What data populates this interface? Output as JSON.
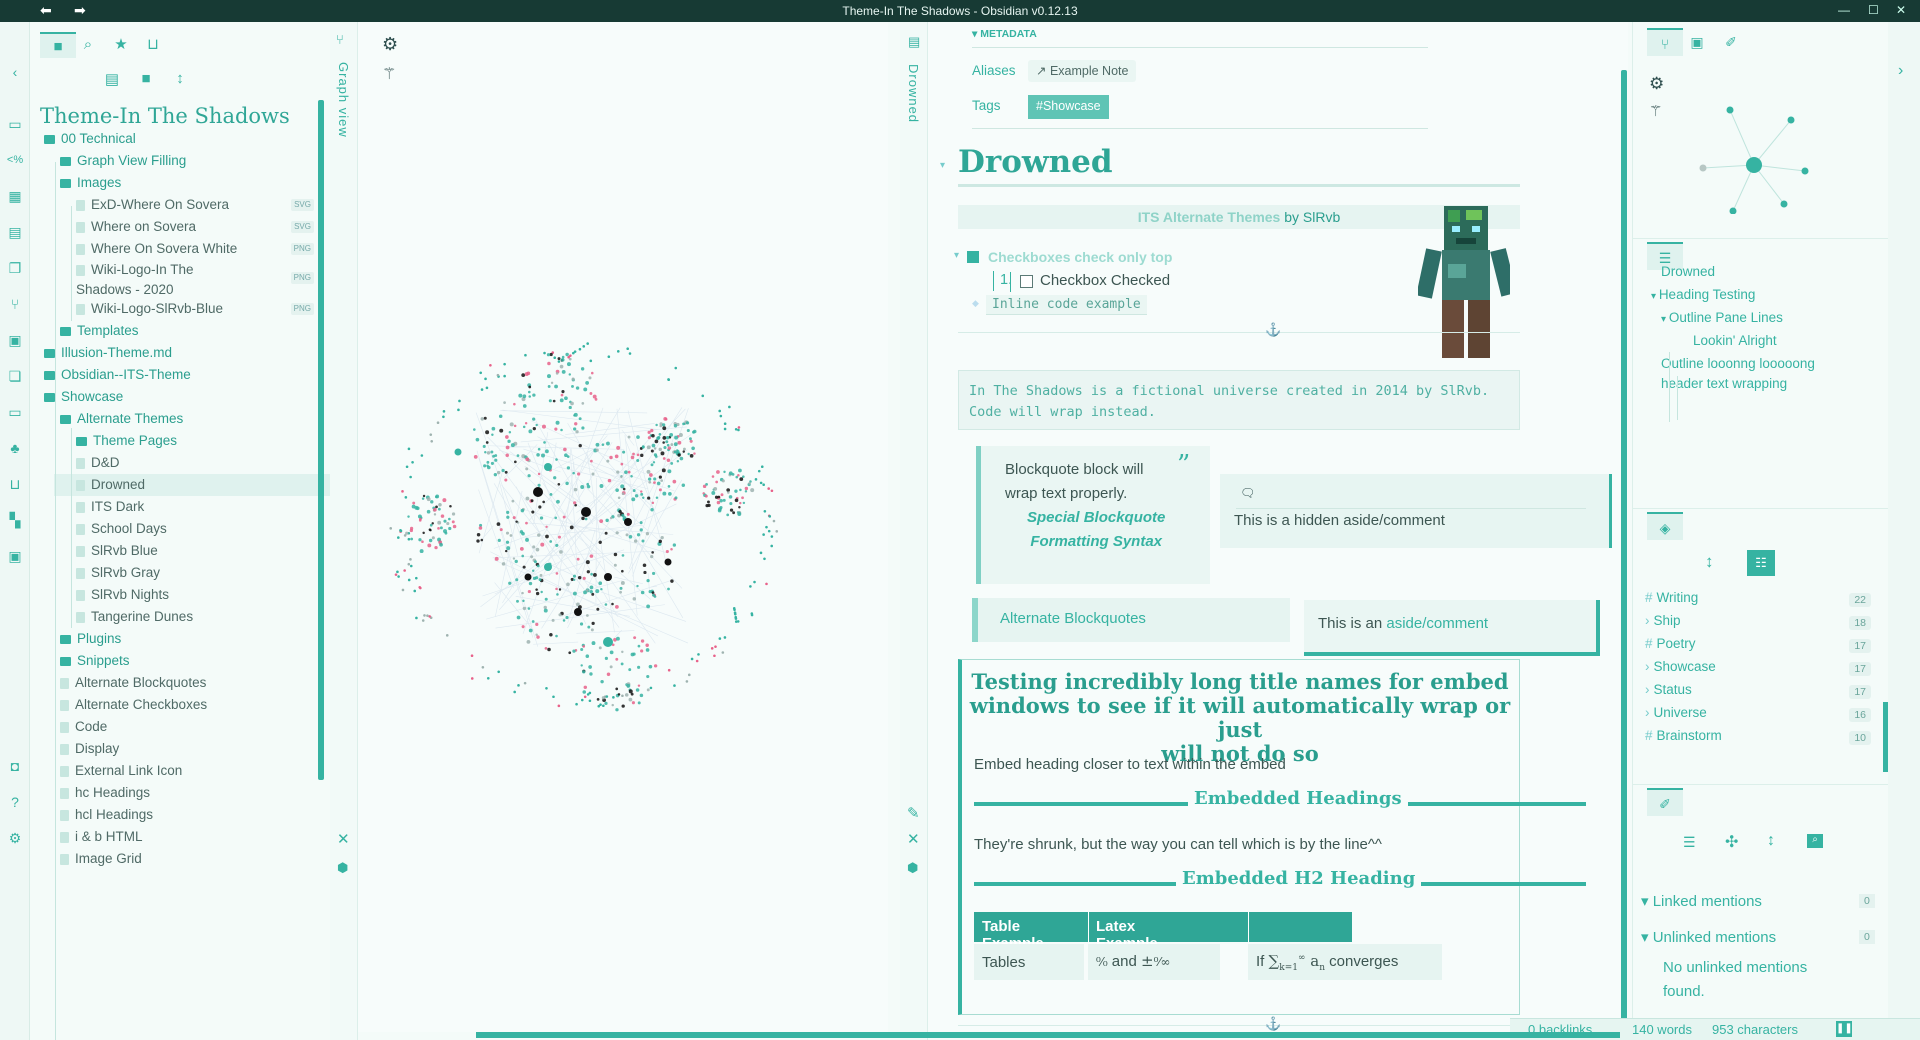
{
  "window": {
    "title": "Theme-In The Shadows - Obsidian v0.12.13"
  },
  "explorer": {
    "vault_name": "Theme-In The Shadows",
    "items": [
      {
        "label": "00 Technical",
        "type": "folder",
        "depth": 0
      },
      {
        "label": "Graph View Filling",
        "type": "folder",
        "depth": 1
      },
      {
        "label": "Images",
        "type": "folder",
        "depth": 1
      },
      {
        "label": "ExD-Where On Sovera",
        "type": "file",
        "depth": 2,
        "badge": "SVG"
      },
      {
        "label": "Where on Sovera",
        "type": "file",
        "depth": 2,
        "badge": "SVG"
      },
      {
        "label": "Where On Sovera White",
        "type": "file",
        "depth": 2,
        "badge": "PNG"
      },
      {
        "label": "Wiki-Logo-In The",
        "label2": "Shadows - 2020",
        "type": "file",
        "depth": 2,
        "badge": "PNG"
      },
      {
        "label": "Wiki-Logo-SlRvb-Blue",
        "type": "file",
        "depth": 2,
        "badge": "PNG"
      },
      {
        "label": "Templates",
        "type": "folder",
        "depth": 1
      },
      {
        "label": "Illusion-Theme.md",
        "type": "folder",
        "depth": 0
      },
      {
        "label": "Obsidian--ITS-Theme",
        "type": "folder",
        "depth": 0
      },
      {
        "label": "Showcase",
        "type": "folder",
        "depth": 0
      },
      {
        "label": "Alternate Themes",
        "type": "folder",
        "depth": 1
      },
      {
        "label": "Theme Pages",
        "type": "folder",
        "depth": 2
      },
      {
        "label": "D&D",
        "type": "file",
        "depth": 2
      },
      {
        "label": "Drowned",
        "type": "file",
        "depth": 2,
        "selected": true
      },
      {
        "label": "ITS Dark",
        "type": "file",
        "depth": 2
      },
      {
        "label": "School Days",
        "type": "file",
        "depth": 2
      },
      {
        "label": "SlRvb Blue",
        "type": "file",
        "depth": 2
      },
      {
        "label": "SlRvb Gray",
        "type": "file",
        "depth": 2
      },
      {
        "label": "SlRvb Nights",
        "type": "file",
        "depth": 2
      },
      {
        "label": "Tangerine Dunes",
        "type": "file",
        "depth": 2
      },
      {
        "label": "Plugins",
        "type": "folder",
        "depth": 1
      },
      {
        "label": "Snippets",
        "type": "folder",
        "depth": 1
      },
      {
        "label": "Alternate Blockquotes",
        "type": "file",
        "depth": 1
      },
      {
        "label": "Alternate Checkboxes",
        "type": "file",
        "depth": 1
      },
      {
        "label": "Code",
        "type": "file",
        "depth": 1
      },
      {
        "label": "Display",
        "type": "file",
        "depth": 1
      },
      {
        "label": "External Link Icon",
        "type": "file",
        "depth": 1
      },
      {
        "label": "hc Headings",
        "type": "file",
        "depth": 1
      },
      {
        "label": "hcl Headings",
        "type": "file",
        "depth": 1
      },
      {
        "label": "i & b HTML",
        "type": "file",
        "depth": 1
      },
      {
        "label": "Image Grid",
        "type": "file",
        "depth": 1
      }
    ]
  },
  "graph": {
    "title": "Graph view"
  },
  "editor": {
    "tab_title": "Drowned",
    "metadata_label": "METADATA",
    "aliases_label": "Aliases",
    "alias_value": "Example Note",
    "tags_label": "Tags",
    "tag_value": "#Showcase",
    "h1": "Drowned",
    "banner_link": "ITS Alternate Themes",
    "banner_by": "by",
    "banner_author": "SlRvb",
    "checkbox_heading": "Checkboxes check only top",
    "list_number": "1.",
    "checkbox_item": "Checkbox Checked",
    "inline_code": "Inline code example",
    "code_block_line1": "In The Shadows is a fictional universe created in 2014 by SlRvb.",
    "code_block_line2": "Code will wrap instead.",
    "blockquote_line1": "Blockquote block will",
    "blockquote_line2": "wrap text properly.",
    "blockquote_special1": "Special Blockquote",
    "blockquote_special2": "Formatting Syntax",
    "aside_text": "This is a hidden aside/comment",
    "alt_blockquotes": "Alternate Blockquotes",
    "aside2_prefix": "This is an",
    "aside2_link": "aside/comment",
    "embed_title_l1": "Testing incredibly long title names for embed",
    "embed_title_l2": "windows to see if it will automatically wrap or just",
    "embed_title_l3": "will not do so",
    "embed_text1": "Embed heading closer to text within the embed",
    "embed_h1": "Embedded Headings",
    "embed_text2": "They're shrunk, but the way you can tell which is by the line^^",
    "embed_h2": "Embedded H2 Heading",
    "table": {
      "headers": [
        "Table Example",
        "Latex Example"
      ],
      "cell1": "Tables",
      "cell2_and": "and",
      "cell3_if": "If",
      "cell3_converges": "converges"
    }
  },
  "outline": {
    "items": [
      {
        "label": "Drowned",
        "depth": 0
      },
      {
        "label": "Heading Testing",
        "depth": 0
      },
      {
        "label": "Outline Pane Lines",
        "depth": 1
      },
      {
        "label": "Lookin' Alright",
        "depth": 2
      },
      {
        "label": "Outline looonng looooong",
        "label2": "header text wrapping",
        "depth": 0
      }
    ]
  },
  "tags": {
    "items": [
      {
        "label": "Writing",
        "count": "22",
        "prefix": "#"
      },
      {
        "label": "Ship",
        "count": "18",
        "prefix": "›"
      },
      {
        "label": "Poetry",
        "count": "17",
        "prefix": "#"
      },
      {
        "label": "Showcase",
        "count": "17",
        "prefix": "›"
      },
      {
        "label": "Status",
        "count": "17",
        "prefix": "›"
      },
      {
        "label": "Universe",
        "count": "16",
        "prefix": "›"
      },
      {
        "label": "Brainstorm",
        "count": "10",
        "prefix": "#"
      }
    ]
  },
  "backlinks": {
    "linked_label": "Linked mentions",
    "linked_count": "0",
    "unlinked_label": "Unlinked mentions",
    "unlinked_count": "0",
    "no_unlinked": "No unlinked mentions found."
  },
  "status": {
    "backlinks": "0 backlinks",
    "words": "140 words",
    "characters": "953 characters"
  },
  "colors": {
    "accent": "#36b3a2",
    "dark": "#173a34",
    "pink": "#e8628a"
  }
}
